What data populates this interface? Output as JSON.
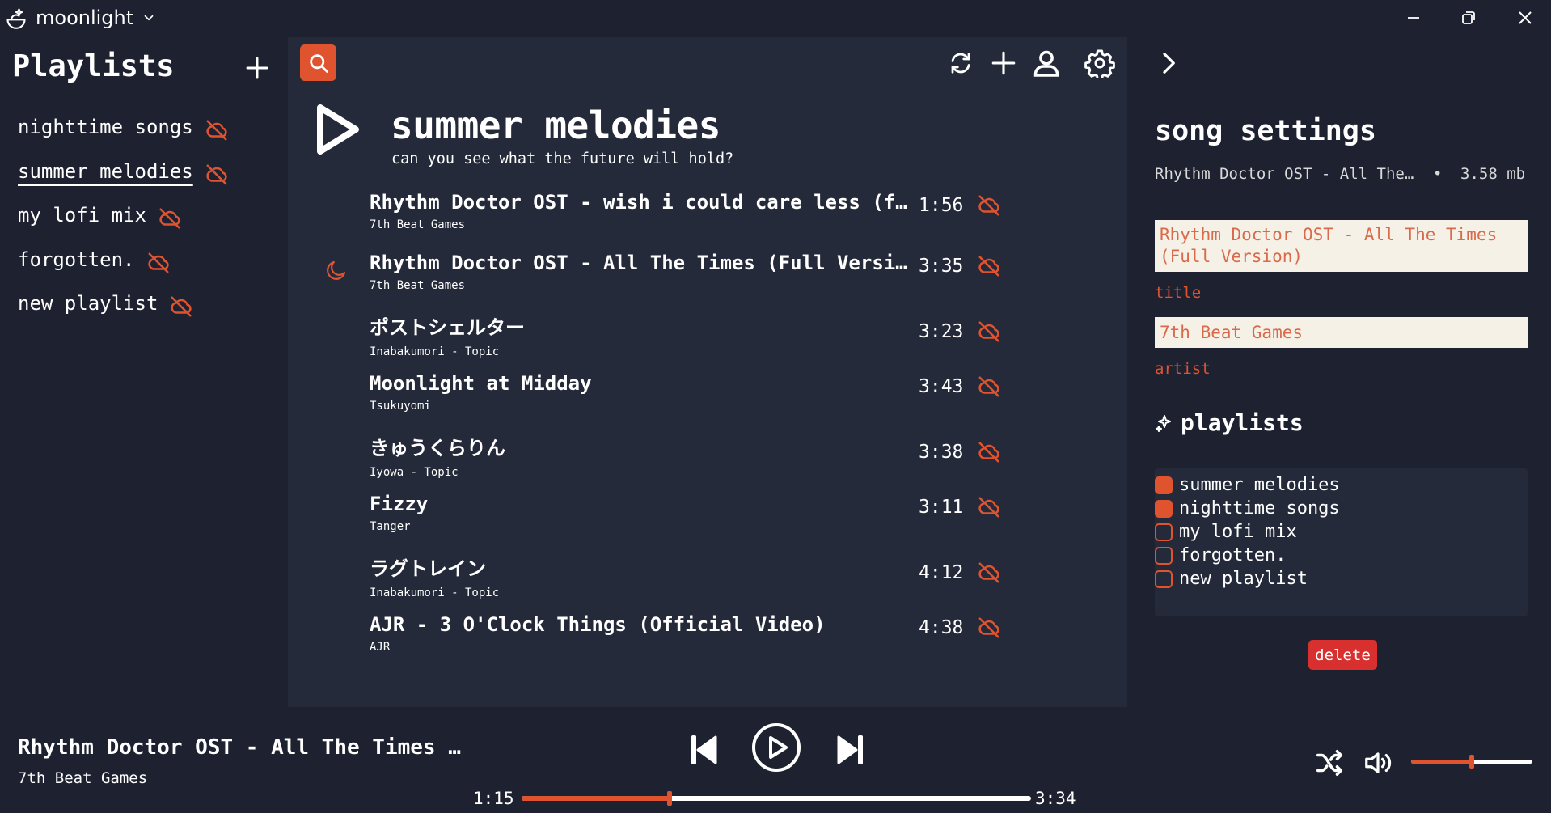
{
  "colors": {
    "accent": "#e0532f",
    "background": "#1e2230",
    "panel": "#252a3a",
    "danger": "#d7302f",
    "field_bg": "#f6f1e6"
  },
  "app": {
    "name": "moonlight"
  },
  "window_controls": [
    "minimize-icon",
    "restore-icon",
    "close-icon"
  ],
  "sidebar": {
    "title": "Playlists",
    "add_icon": "plus-icon",
    "items": [
      {
        "label": "nighttime songs",
        "icon": "cloud-off-icon",
        "active": false
      },
      {
        "label": "summer melodies",
        "icon": "cloud-off-icon",
        "active": true
      },
      {
        "label": "my lofi mix",
        "icon": "cloud-off-icon",
        "active": false
      },
      {
        "label": "forgotten.",
        "icon": "cloud-off-icon",
        "active": false
      },
      {
        "label": "new playlist",
        "icon": "cloud-off-icon",
        "active": false
      }
    ]
  },
  "toolbar": {
    "icons": [
      "search-icon",
      "refresh-icon",
      "plus-icon",
      "user-icon",
      "gear-icon"
    ]
  },
  "playlist": {
    "title": "summer melodies",
    "subtitle": "can you see what the future will hold?",
    "songs": [
      {
        "title": "Rhythm Doctor OST - wish i could care less (ft. Bunlife)",
        "artist": "7th Beat Games",
        "duration": "1:56",
        "playing": false
      },
      {
        "title": "Rhythm Doctor OST - All The Times (Full Version)",
        "artist": "7th Beat Games",
        "duration": "3:35",
        "playing": true
      },
      {
        "title": "ポストシェルター",
        "artist": "Inabakumori - Topic",
        "duration": "3:23",
        "playing": false
      },
      {
        "title": "Moonlight at Midday",
        "artist": "Tsukuyomi",
        "duration": "3:43",
        "playing": false
      },
      {
        "title": "きゅうくらりん",
        "artist": "Iyowa - Topic",
        "duration": "3:38",
        "playing": false
      },
      {
        "title": "Fizzy",
        "artist": "Tanger",
        "duration": "3:11",
        "playing": false
      },
      {
        "title": "ラグトレイン",
        "artist": "Inabakumori - Topic",
        "duration": "4:12",
        "playing": false
      },
      {
        "title": "AJR - 3 O'Clock Things (Official Video)",
        "artist": "AJR",
        "duration": "4:38",
        "playing": false
      }
    ]
  },
  "settings": {
    "title": "song settings",
    "file_name": "Rhythm Doctor OST - All The Times (Full Version)",
    "separator": "•",
    "file_size": "3.58 mb",
    "title_value": "Rhythm Doctor OST - All The Times (Full Version)",
    "title_label": "title",
    "artist_value": "7th Beat Games",
    "artist_label": "artist",
    "playlists_heading": "playlists",
    "playlists": [
      {
        "label": "summer melodies",
        "checked": true
      },
      {
        "label": "nighttime songs",
        "checked": true
      },
      {
        "label": "my lofi mix",
        "checked": false
      },
      {
        "label": "forgotten.",
        "checked": false
      },
      {
        "label": "new playlist",
        "checked": false
      }
    ],
    "delete_label": "delete"
  },
  "player": {
    "title": "Rhythm Doctor OST - All The Times (Full Version)",
    "artist": "7th Beat Games",
    "elapsed": "1:15",
    "total": "3:34",
    "progress": 0.29,
    "volume": 0.5
  }
}
